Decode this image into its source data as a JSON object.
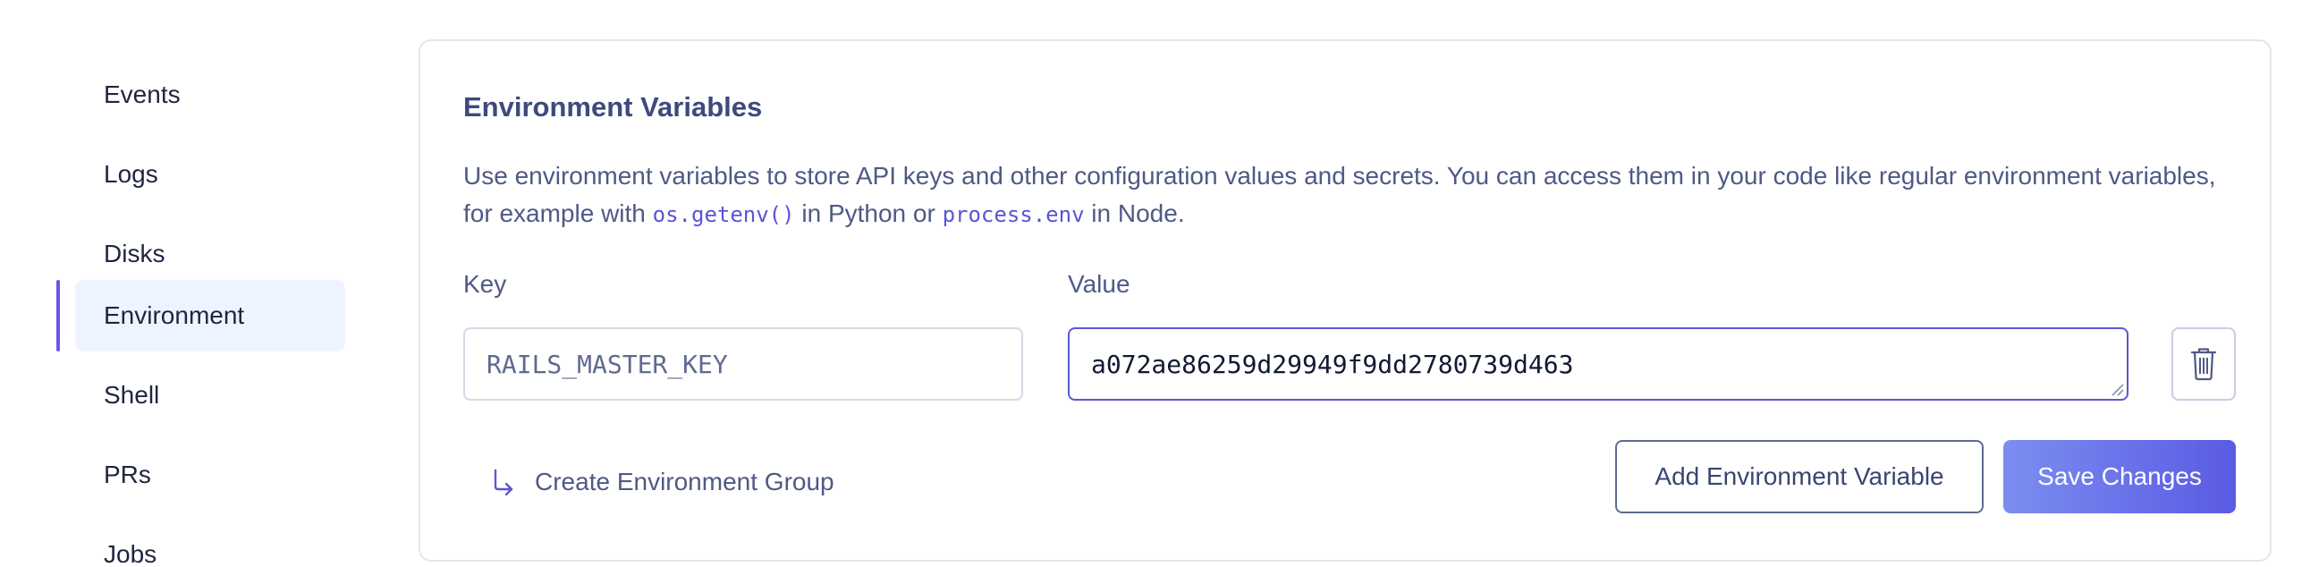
{
  "sidebar": {
    "items": [
      {
        "label": "Events"
      },
      {
        "label": "Logs"
      },
      {
        "label": "Disks"
      },
      {
        "label": "Environment",
        "active": true
      },
      {
        "label": "Shell"
      },
      {
        "label": "PRs"
      },
      {
        "label": "Jobs"
      }
    ]
  },
  "env_section": {
    "title": "Environment Variables",
    "description": {
      "part1": "Use environment variables to store API keys and other configuration values and secrets. You can access them in your code like regular environment variables, for example with ",
      "code1": "os.getenv()",
      "part2": " in Python or ",
      "code2": "process.env",
      "part3": " in Node."
    },
    "key_label": "Key",
    "value_label": "Value",
    "variables": [
      {
        "key": "RAILS_MASTER_KEY",
        "value": "a072ae86259d29949f9dd2780739d463"
      }
    ],
    "create_group_label": "Create Environment Group",
    "add_button_label": "Add Environment Variable",
    "save_button_label": "Save Changes"
  },
  "colors": {
    "accent": "#5b5ae3",
    "active_nav_bg": "#eef4ff",
    "active_indicator": "#6a57e8",
    "code_text": "#5a54d6"
  },
  "icons": {
    "delete": "trash-icon",
    "create_group": "arrow-down-right-icon",
    "resize": "resize-grip-icon"
  }
}
